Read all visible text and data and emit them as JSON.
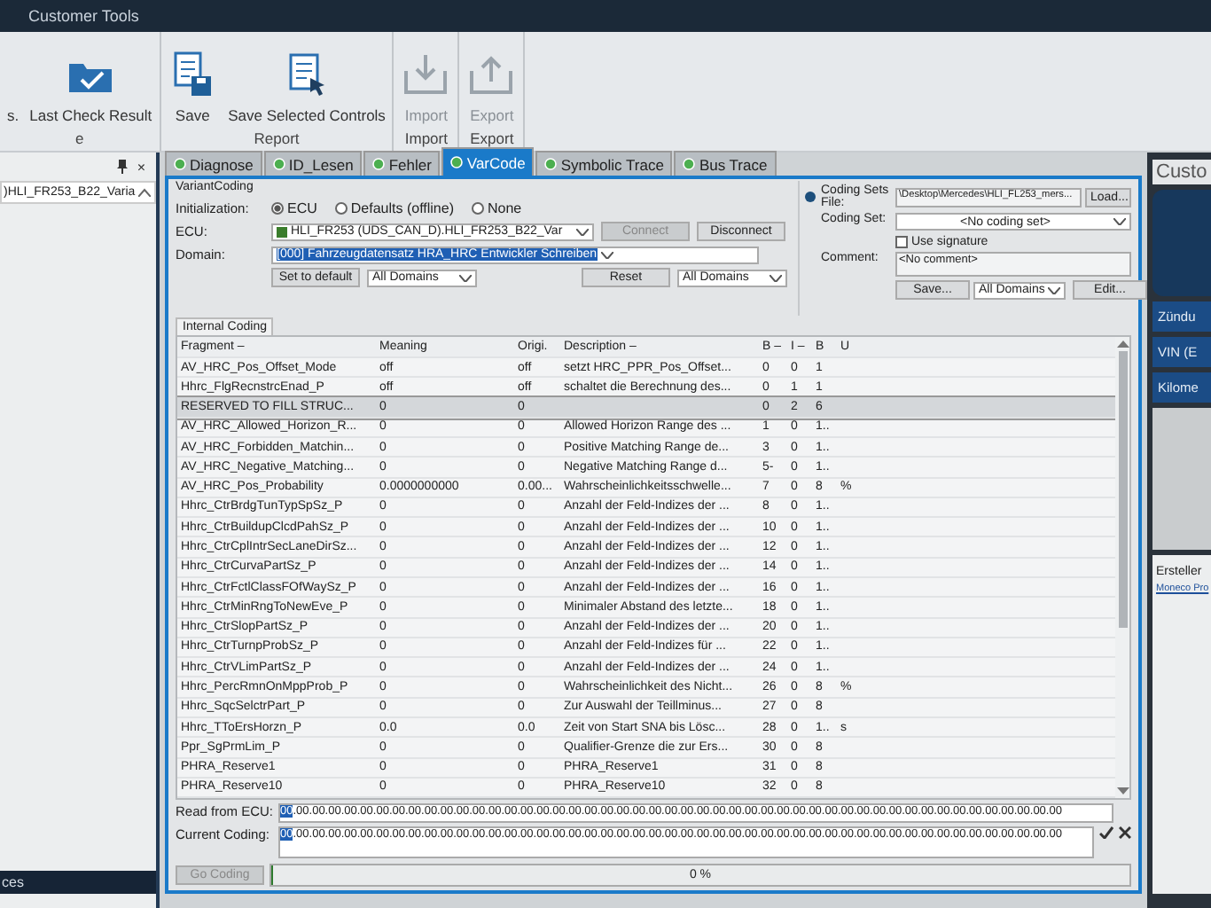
{
  "title_bar": {
    "menu": "Customer Tools"
  },
  "ribbon": {
    "groups": [
      {
        "label": "e",
        "buttons": [
          {
            "label": "s.",
            "disabled": false
          },
          {
            "label": "Last Check Result",
            "disabled": false
          }
        ]
      },
      {
        "label": "Report",
        "buttons": [
          {
            "label": "Save",
            "disabled": false
          },
          {
            "label": "Save Selected Controls",
            "disabled": false
          }
        ]
      },
      {
        "label": "Import",
        "buttons": [
          {
            "label": "Import",
            "disabled": true
          }
        ]
      },
      {
        "label": "Export",
        "buttons": [
          {
            "label": "Export",
            "disabled": true
          }
        ]
      }
    ]
  },
  "left_panel": {
    "close": "×",
    "tree_item": ")HLI_FR253_B22_Varia",
    "footer": "ces"
  },
  "tabs": [
    {
      "label": "Diagnose",
      "selected": false
    },
    {
      "label": "ID_Lesen",
      "selected": false
    },
    {
      "label": "Fehler",
      "selected": false
    },
    {
      "label": "VarCode",
      "selected": true
    },
    {
      "label": "Symbolic Trace",
      "selected": false
    },
    {
      "label": "Bus Trace",
      "selected": false
    }
  ],
  "variant_coding": {
    "title": "VariantCoding",
    "init_label": "Initialization:",
    "init_options": [
      {
        "label": "ECU",
        "selected": true
      },
      {
        "label": "Defaults (offline)",
        "selected": false
      },
      {
        "label": "None",
        "selected": false
      }
    ],
    "ecu_label": "ECU:",
    "ecu_value": "HLI_FR253 (UDS_CAN_D).HLI_FR253_B22_Var",
    "connect": "Connect",
    "disconnect": "Disconnect",
    "domain_label": "Domain:",
    "domain_value": "[000] Fahrzeugdatensatz HRA_HRC Entwickler Schreiben",
    "set_default": "Set to default",
    "domains_left": "All Domains",
    "reset": "Reset",
    "domains_mid": "All Domains",
    "coding_sets_label": "Coding Sets File:",
    "file_path": "\\Desktop\\Mercedes\\HLI_FL253_mers...",
    "load": "Load...",
    "coding_set_label": "Coding Set:",
    "coding_set_value": "<No coding set>",
    "use_signature": {
      "label": "Use signature",
      "checked": false
    },
    "comment_label": "Comment:",
    "comment_value": "<No comment>",
    "save": "Save...",
    "domains_right": "All Domains",
    "edit": "Edit..."
  },
  "internal_coding": {
    "tab": "Internal Coding",
    "columns": [
      "Fragment –",
      "Meaning",
      "Origi.",
      "Description –",
      "B –",
      "I –",
      "B",
      "U"
    ],
    "rows": [
      {
        "selected": false,
        "cells": [
          "AV_HRC_Pos_Offset_Mode",
          "off",
          "off",
          "setzt HRC_PPR_Pos_Offset...",
          "0",
          "0",
          "1",
          ""
        ]
      },
      {
        "selected": false,
        "cells": [
          "Hhrc_FlgRecnstrcEnad_P",
          "off",
          "off",
          "schaltet die Berechnung des...",
          "0",
          "1",
          "1",
          ""
        ]
      },
      {
        "selected": true,
        "cells": [
          "RESERVED TO FILL STRUC...",
          "0",
          "0",
          "",
          "0",
          "2",
          "6",
          ""
        ]
      },
      {
        "selected": false,
        "cells": [
          "AV_HRC_Allowed_Horizon_R...",
          "0",
          "0",
          "Allowed Horizon Range des ...",
          "1",
          "0",
          "1..",
          ""
        ]
      },
      {
        "selected": false,
        "cells": [
          "AV_HRC_Forbidden_Matchin...",
          "0",
          "0",
          "Positive Matching Range de...",
          "3",
          "0",
          "1..",
          ""
        ]
      },
      {
        "selected": false,
        "cells": [
          "AV_HRC_Negative_Matching...",
          "0",
          "0",
          "Negative Matching Range d...",
          "5-",
          "0",
          "1..",
          ""
        ]
      },
      {
        "selected": false,
        "cells": [
          "AV_HRC_Pos_Probability",
          "0.0000000000",
          "0.00...",
          "Wahrscheinlichkeitsschwelle...",
          "7",
          "0",
          "8",
          "%"
        ]
      },
      {
        "selected": false,
        "cells": [
          "Hhrc_CtrBrdgTunTypSpSz_P",
          "0",
          "0",
          "Anzahl der Feld-Indizes der ...",
          "8",
          "0",
          "1..",
          ""
        ]
      },
      {
        "selected": false,
        "cells": [
          "Hhrc_CtrBuildupClcdPahSz_P",
          "0",
          "0",
          "Anzahl der Feld-Indizes der ...",
          "10",
          "0",
          "1..",
          ""
        ]
      },
      {
        "selected": false,
        "cells": [
          "Hhrc_CtrCplIntrSecLaneDirSz...",
          "0",
          "0",
          "Anzahl der Feld-Indizes der ...",
          "12",
          "0",
          "1..",
          ""
        ]
      },
      {
        "selected": false,
        "cells": [
          "Hhrc_CtrCurvaPartSz_P",
          "0",
          "0",
          "Anzahl der Feld-Indizes der ...",
          "14",
          "0",
          "1..",
          ""
        ]
      },
      {
        "selected": false,
        "cells": [
          "Hhrc_CtrFctlClassFOfWaySz_P",
          "0",
          "0",
          "Anzahl der Feld-Indizes der ...",
          "16",
          "0",
          "1..",
          ""
        ]
      },
      {
        "selected": false,
        "cells": [
          "Hhrc_CtrMinRngToNewEve_P",
          "0",
          "0",
          "Minimaler Abstand des letzte...",
          "18",
          "0",
          "1..",
          ""
        ]
      },
      {
        "selected": false,
        "cells": [
          "Hhrc_CtrSlopPartSz_P",
          "0",
          "0",
          "Anzahl der Feld-Indizes der ...",
          "20",
          "0",
          "1..",
          ""
        ]
      },
      {
        "selected": false,
        "cells": [
          "Hhrc_CtrTurnpProbSz_P",
          "0",
          "0",
          "Anzahl der Feld-Indizes für ...",
          "22",
          "0",
          "1..",
          ""
        ]
      },
      {
        "selected": false,
        "cells": [
          "Hhrc_CtrVLimPartSz_P",
          "0",
          "0",
          "Anzahl der Feld-Indizes der ...",
          "24",
          "0",
          "1..",
          ""
        ]
      },
      {
        "selected": false,
        "cells": [
          "Hhrc_PercRmnOnMppProb_P",
          "0",
          "0",
          "Wahrscheinlichkeit des Nicht...",
          "26",
          "0",
          "8",
          "%"
        ]
      },
      {
        "selected": false,
        "cells": [
          "Hhrc_SqcSelctrPart_P",
          "0",
          "0",
          "Zur Auswahl der Teillminus...",
          "27",
          "0",
          "8",
          ""
        ]
      },
      {
        "selected": false,
        "cells": [
          "Hhrc_TToErsHorzn_P",
          "0.0",
          "0.0",
          "Zeit von Start SNA bis Lösc...",
          "28",
          "0",
          "1..",
          "s"
        ]
      },
      {
        "selected": false,
        "cells": [
          "Ppr_SgPrmLim_P",
          "0",
          "0",
          "Qualifier-Grenze die zur Ers...",
          "30",
          "0",
          "8",
          ""
        ]
      },
      {
        "selected": false,
        "cells": [
          "PHRA_Reserve1",
          "0",
          "0",
          "PHRA_Reserve1",
          "31",
          "0",
          "8",
          ""
        ]
      },
      {
        "selected": false,
        "cells": [
          "PHRA_Reserve10",
          "0",
          "0",
          "PHRA_Reserve10",
          "32",
          "0",
          "8",
          ""
        ]
      }
    ]
  },
  "read_from_ecu": {
    "label": "Read from ECU:",
    "highlighted": "00",
    "value": ".00.00.00.00.00.00.00.00.00.00.00.00.00.00.00.00.00.00.00.00.00.00.00.00.00.00.00.00.00.00.00.00.00.00.00.00.00.00.00.00.00.00.00.00.00.00.00.00"
  },
  "current_coding": {
    "label": "Current Coding:",
    "highlighted": "00",
    "value": ".00.00.00.00.00.00.00.00.00.00.00.00.00.00.00.00.00.00.00.00.00.00.00.00.00.00.00.00.00.00.00.00.00.00.00.00.00.00.00.00.00.00.00.00.00.00.00.00"
  },
  "go_coding": {
    "label": "Go Coding",
    "disabled": true
  },
  "progress": {
    "level": 0,
    "reading": "0 %"
  },
  "right_panel": {
    "title": "Custo",
    "buttons": [
      "Zündu",
      "VIN (E",
      "Kilome"
    ],
    "creator_label": "Ersteller",
    "creator_link": "Moneco Pro"
  }
}
